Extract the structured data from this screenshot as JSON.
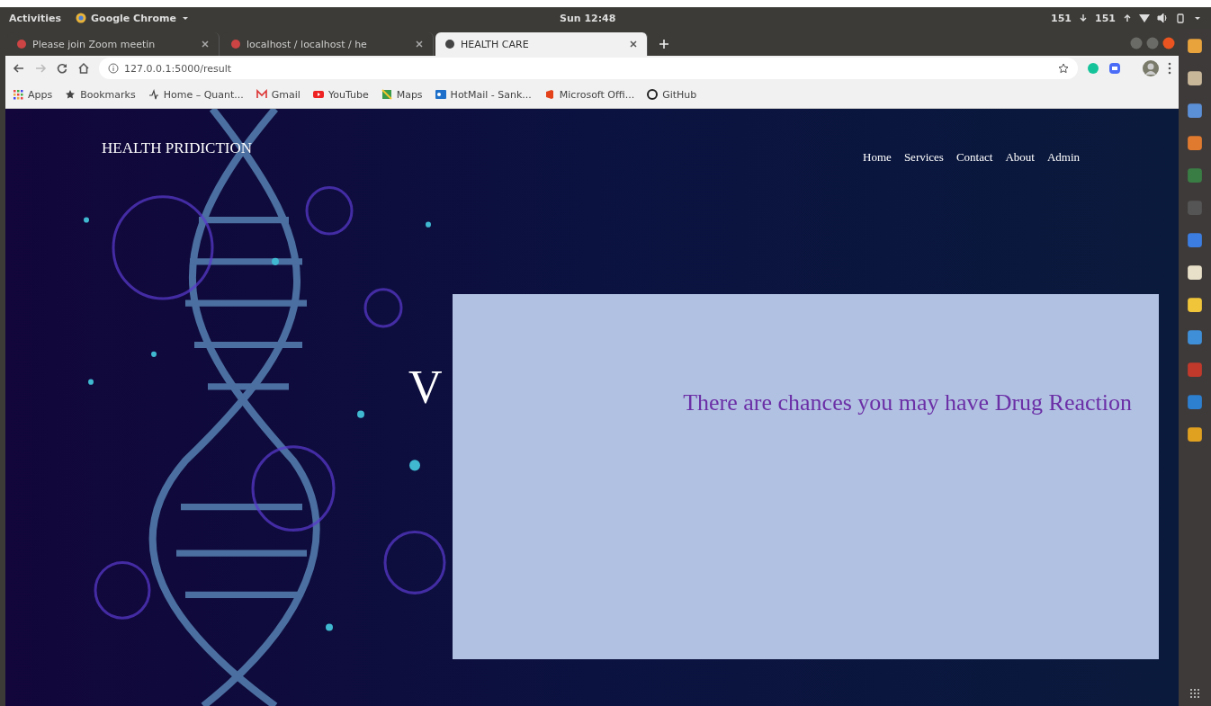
{
  "top_bar": {
    "activities": "Activities",
    "app_menu": "Google Chrome",
    "clock": "Sun 12:48",
    "net_down": "151",
    "net_up": "151"
  },
  "tabs": [
    {
      "title": "Please join Zoom meetin",
      "selected": false
    },
    {
      "title": "localhost / localhost / he",
      "selected": false
    },
    {
      "title": "HEALTH CARE",
      "selected": true
    }
  ],
  "address_bar": {
    "url": "127.0.0.1:5000/result"
  },
  "bookmarks": [
    {
      "kind": "apps",
      "label": "Apps"
    },
    {
      "kind": "star",
      "label": "Bookmarks"
    },
    {
      "kind": "pulse",
      "label": "Home – Quant..."
    },
    {
      "kind": "mail",
      "label": "Gmail"
    },
    {
      "kind": "video",
      "label": "YouTube"
    },
    {
      "kind": "map",
      "label": "Maps"
    },
    {
      "kind": "outlook",
      "label": "HotMail - Sank..."
    },
    {
      "kind": "office",
      "label": "Microsoft Offi..."
    },
    {
      "kind": "github",
      "label": "GitHub"
    }
  ],
  "page": {
    "logo": "HEALTH PRIDICTION",
    "nav": [
      "Home",
      "Services",
      "Contact",
      "About",
      "Admin"
    ],
    "heading": "V",
    "result": "There are chances you may have Drug Reaction"
  }
}
